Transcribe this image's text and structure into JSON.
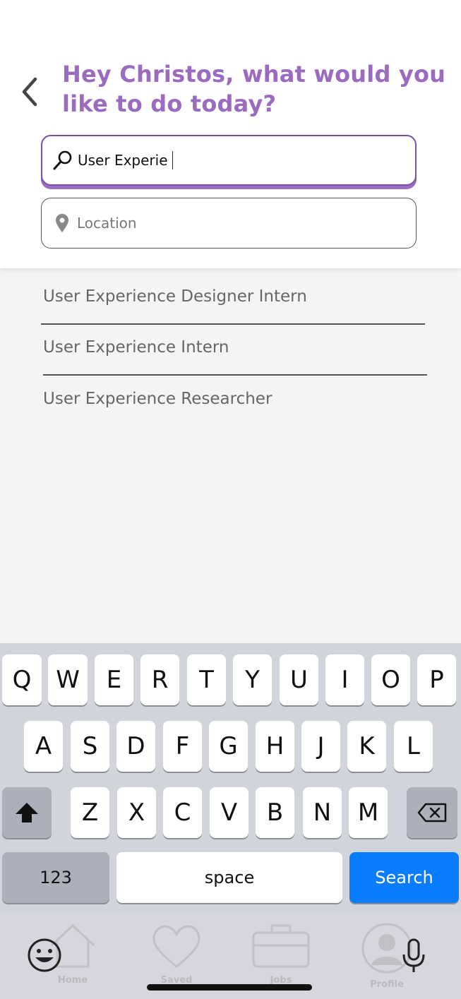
{
  "header": {
    "greeting": "Hey Christos, what would you like to do today?",
    "search_value": "User Experie",
    "location_placeholder": "Location"
  },
  "suggestions": [
    "User Experience Designer Intern",
    "User Experience Intern",
    "User Experience Researcher"
  ],
  "tabs": [
    "Home",
    "Saved",
    "Jobs",
    "Profile"
  ],
  "keyboard": {
    "row1": [
      "Q",
      "W",
      "E",
      "R",
      "T",
      "Y",
      "U",
      "I",
      "O",
      "P"
    ],
    "row2": [
      "A",
      "S",
      "D",
      "F",
      "G",
      "H",
      "J",
      "K",
      "L"
    ],
    "row3": [
      "Z",
      "X",
      "C",
      "V",
      "B",
      "N",
      "M"
    ],
    "numbers_label": "123",
    "space_label": "space",
    "action_label": "Search"
  },
  "colors": {
    "accent_purple": "#9b6bc0",
    "search_border": "#7a50a8",
    "action_blue": "#0a7cff"
  }
}
